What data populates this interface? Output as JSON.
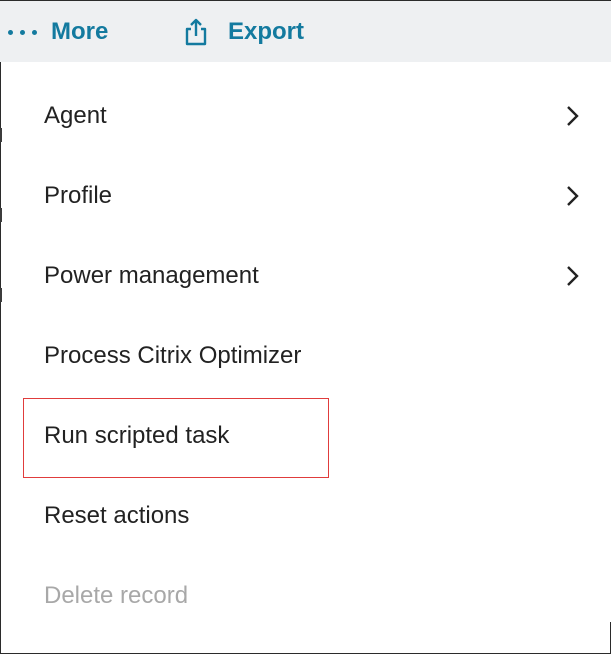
{
  "toolbar": {
    "more_label": "More",
    "export_label": "Export",
    "more_icon": "ellipsis-icon",
    "export_icon": "share-export-icon",
    "accent_color": "#137a9f"
  },
  "menu": {
    "items": [
      {
        "label": "Agent",
        "has_submenu": true,
        "disabled": false
      },
      {
        "label": "Profile",
        "has_submenu": true,
        "disabled": false
      },
      {
        "label": "Power management",
        "has_submenu": true,
        "disabled": false
      },
      {
        "label": "Process Citrix Optimizer",
        "has_submenu": false,
        "disabled": false
      },
      {
        "label": "Run scripted task",
        "has_submenu": false,
        "disabled": false,
        "highlighted": true
      },
      {
        "label": "Reset actions",
        "has_submenu": false,
        "disabled": false
      },
      {
        "label": "Delete record",
        "has_submenu": false,
        "disabled": true
      }
    ],
    "highlight_color": "#e03c3c",
    "disabled_color": "#a8a8a8"
  }
}
